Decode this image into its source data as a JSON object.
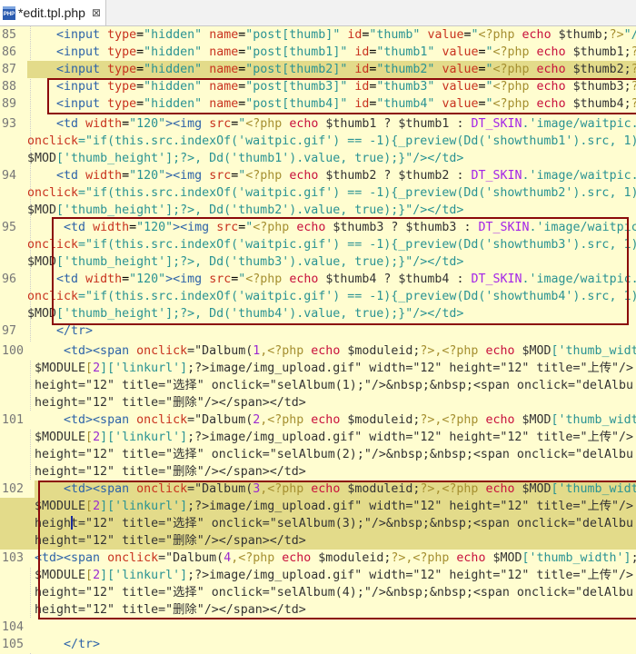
{
  "tab": {
    "title": "*edit.tpl.php",
    "icon": "php-file-icon",
    "close": "⊠"
  },
  "colors": {
    "background": "#fffdd0",
    "highlight": "#e3db8a",
    "box": "#8b0a0a"
  },
  "rows": [
    {
      "n": "85",
      "segs": [
        [
          "    ",
          ""
        ],
        [
          "<input",
          "t"
        ],
        [
          " ",
          ""
        ],
        [
          "type",
          "a"
        ],
        [
          "=",
          ""
        ],
        [
          "\"hidden\"",
          "s"
        ],
        [
          " ",
          ""
        ],
        [
          "name",
          "a"
        ],
        [
          "=",
          ""
        ],
        [
          "\"post[thumb]\"",
          "s"
        ],
        [
          " ",
          ""
        ],
        [
          "id",
          "a"
        ],
        [
          "=",
          ""
        ],
        [
          "\"thumb\"",
          "s"
        ],
        [
          " ",
          ""
        ],
        [
          "value",
          "a"
        ],
        [
          "=",
          ""
        ],
        [
          "\"",
          "s"
        ],
        [
          "<?php",
          "p"
        ],
        [
          " ",
          ""
        ],
        [
          "echo",
          "k"
        ],
        [
          " $thumb;",
          "v"
        ],
        [
          "?>",
          "p"
        ],
        [
          "\"/",
          "s"
        ]
      ]
    },
    {
      "n": "86",
      "segs": [
        [
          "    ",
          ""
        ],
        [
          "<input",
          "t"
        ],
        [
          " ",
          ""
        ],
        [
          "type",
          "a"
        ],
        [
          "=",
          ""
        ],
        [
          "\"hidden\"",
          "s"
        ],
        [
          " ",
          ""
        ],
        [
          "name",
          "a"
        ],
        [
          "=",
          ""
        ],
        [
          "\"post[thumb1]\"",
          "s"
        ],
        [
          " ",
          ""
        ],
        [
          "id",
          "a"
        ],
        [
          "=",
          ""
        ],
        [
          "\"thumb1\"",
          "s"
        ],
        [
          " ",
          ""
        ],
        [
          "value",
          "a"
        ],
        [
          "=",
          ""
        ],
        [
          "\"",
          "s"
        ],
        [
          "<?php",
          "p"
        ],
        [
          " ",
          ""
        ],
        [
          "echo",
          "k"
        ],
        [
          " $thumb1;",
          "v"
        ],
        [
          "?",
          "p"
        ]
      ]
    },
    {
      "n": "87",
      "hl": true,
      "segs": [
        [
          "    ",
          ""
        ],
        [
          "<input",
          "t"
        ],
        [
          " ",
          ""
        ],
        [
          "type",
          "a"
        ],
        [
          "=",
          ""
        ],
        [
          "\"hidden\"",
          "s"
        ],
        [
          " ",
          ""
        ],
        [
          "name",
          "a"
        ],
        [
          "=",
          ""
        ],
        [
          "\"post[thumb2]\"",
          "s"
        ],
        [
          " ",
          ""
        ],
        [
          "id",
          "a"
        ],
        [
          "=",
          ""
        ],
        [
          "\"thumb2\"",
          "s"
        ],
        [
          " ",
          ""
        ],
        [
          "value",
          "a"
        ],
        [
          "=",
          ""
        ],
        [
          "\"",
          "s"
        ],
        [
          "<?php",
          "p"
        ],
        [
          " ",
          ""
        ],
        [
          "echo",
          "k"
        ],
        [
          " $thumb2;",
          "v"
        ],
        [
          "?",
          "p"
        ]
      ]
    },
    {
      "n": "88",
      "segs": [
        [
          "    ",
          ""
        ],
        [
          "<input",
          "t"
        ],
        [
          " ",
          ""
        ],
        [
          "type",
          "a"
        ],
        [
          "=",
          ""
        ],
        [
          "\"hidden\"",
          "s"
        ],
        [
          " ",
          ""
        ],
        [
          "name",
          "a"
        ],
        [
          "=",
          ""
        ],
        [
          "\"post[thumb3]\"",
          "s"
        ],
        [
          " ",
          ""
        ],
        [
          "id",
          "a"
        ],
        [
          "=",
          ""
        ],
        [
          "\"thumb3\"",
          "s"
        ],
        [
          " ",
          ""
        ],
        [
          "value",
          "a"
        ],
        [
          "=",
          ""
        ],
        [
          "\"",
          "s"
        ],
        [
          "<?php",
          "p"
        ],
        [
          " ",
          ""
        ],
        [
          "echo",
          "k"
        ],
        [
          " $thumb3;",
          "v"
        ],
        [
          "?",
          "p"
        ]
      ]
    },
    {
      "n": "89",
      "segs": [
        [
          "    ",
          ""
        ],
        [
          "<input",
          "t"
        ],
        [
          " ",
          ""
        ],
        [
          "type",
          "a"
        ],
        [
          "=",
          ""
        ],
        [
          "\"hidden\"",
          "s"
        ],
        [
          " ",
          ""
        ],
        [
          "name",
          "a"
        ],
        [
          "=",
          ""
        ],
        [
          "\"post[thumb4]\"",
          "s"
        ],
        [
          " ",
          ""
        ],
        [
          "id",
          "a"
        ],
        [
          "=",
          ""
        ],
        [
          "\"thumb4\"",
          "s"
        ],
        [
          " ",
          ""
        ],
        [
          "value",
          "a"
        ],
        [
          "=",
          ""
        ],
        [
          "\"",
          "s"
        ],
        [
          "<?php",
          "p"
        ],
        [
          " ",
          ""
        ],
        [
          "echo",
          "k"
        ],
        [
          " $thumb4;",
          "v"
        ],
        [
          "?",
          "p"
        ]
      ]
    },
    {
      "n": "93",
      "gap": true,
      "segs": [
        [
          "    ",
          ""
        ],
        [
          "<td",
          "t"
        ],
        [
          " ",
          ""
        ],
        [
          "width",
          "a"
        ],
        [
          "=",
          ""
        ],
        [
          "\"120\"",
          "s"
        ],
        [
          "><img",
          "t"
        ],
        [
          " ",
          ""
        ],
        [
          "src",
          "a"
        ],
        [
          "=",
          ""
        ],
        [
          "\"",
          "s"
        ],
        [
          "<?php",
          "p"
        ],
        [
          " ",
          ""
        ],
        [
          "echo",
          "k"
        ],
        [
          " $thumb1 ? $thumb1 : ",
          "v"
        ],
        [
          "DT_SKIN",
          "c"
        ],
        [
          ".'image/waitpic.",
          "s"
        ]
      ]
    },
    {
      "n": "",
      "segs": [
        [
          "onclick",
          "a"
        ],
        [
          "=\"if(this.src.indexOf('waitpic.gif') == -1){_preview(Dd('showthumb1').src, 1)",
          "s"
        ]
      ]
    },
    {
      "n": "",
      "segs": [
        [
          "$MOD",
          "v"
        ],
        [
          "['thumb_height'];?>, Dd('thumb1').value, true);}\"/></td>",
          "s"
        ]
      ]
    },
    {
      "n": "94",
      "segs": [
        [
          "    ",
          ""
        ],
        [
          "<td",
          "t"
        ],
        [
          " ",
          ""
        ],
        [
          "width",
          "a"
        ],
        [
          "=",
          ""
        ],
        [
          "\"120\"",
          "s"
        ],
        [
          "><img",
          "t"
        ],
        [
          " ",
          ""
        ],
        [
          "src",
          "a"
        ],
        [
          "=",
          ""
        ],
        [
          "\"",
          "s"
        ],
        [
          "<?php",
          "p"
        ],
        [
          " ",
          ""
        ],
        [
          "echo",
          "k"
        ],
        [
          " $thumb2 ? $thumb2 : ",
          "v"
        ],
        [
          "DT_SKIN",
          "c"
        ],
        [
          ".'image/waitpic.",
          "s"
        ]
      ]
    },
    {
      "n": "",
      "segs": [
        [
          "onclick",
          "a"
        ],
        [
          "=\"if(this.src.indexOf('waitpic.gif') == -1){_preview(Dd('showthumb2').src, 1)",
          "s"
        ]
      ]
    },
    {
      "n": "",
      "segs": [
        [
          "$MOD",
          "v"
        ],
        [
          "['thumb_height'];?>, Dd('thumb2').value, true);}\"/></td>",
          "s"
        ]
      ]
    },
    {
      "n": "95",
      "segs": [
        [
          "     ",
          ""
        ],
        [
          "<td",
          "t"
        ],
        [
          " ",
          ""
        ],
        [
          "width",
          "a"
        ],
        [
          "=",
          ""
        ],
        [
          "\"120\"",
          "s"
        ],
        [
          "><img",
          "t"
        ],
        [
          " ",
          ""
        ],
        [
          "src",
          "a"
        ],
        [
          "=",
          ""
        ],
        [
          "\"",
          "s"
        ],
        [
          "<?php",
          "p"
        ],
        [
          " ",
          ""
        ],
        [
          "echo",
          "k"
        ],
        [
          " $thumb3 ? $thumb3 : ",
          "v"
        ],
        [
          "DT_SKIN",
          "c"
        ],
        [
          ".'image/waitpic",
          "s"
        ]
      ]
    },
    {
      "n": "",
      "segs": [
        [
          "onclick",
          "a"
        ],
        [
          "=\"if(this.src.indexOf('waitpic.gif') == -1){_preview(Dd('showthumb3').src, 1)",
          "s"
        ]
      ]
    },
    {
      "n": "",
      "segs": [
        [
          "$MOD",
          "v"
        ],
        [
          "['thumb_height'];?>, Dd('thumb3').value, true);}\"/></td>",
          "s"
        ]
      ]
    },
    {
      "n": "96",
      "segs": [
        [
          "    ",
          ""
        ],
        [
          "<td",
          "t"
        ],
        [
          " ",
          ""
        ],
        [
          "width",
          "a"
        ],
        [
          "=",
          ""
        ],
        [
          "\"120\"",
          "s"
        ],
        [
          "><img",
          "t"
        ],
        [
          " ",
          ""
        ],
        [
          "src",
          "a"
        ],
        [
          "=",
          ""
        ],
        [
          "\"",
          "s"
        ],
        [
          "<?php",
          "p"
        ],
        [
          " ",
          ""
        ],
        [
          "echo",
          "k"
        ],
        [
          " $thumb4 ? $thumb4 : ",
          "v"
        ],
        [
          "DT_SKIN",
          "c"
        ],
        [
          ".'image/waitpic.",
          "s"
        ]
      ]
    },
    {
      "n": "",
      "segs": [
        [
          "onclick",
          "a"
        ],
        [
          "=\"if(this.src.indexOf('waitpic.gif') == -1){_preview(Dd('showthumb4').src, 1)",
          "s"
        ]
      ]
    },
    {
      "n": "",
      "segs": [
        [
          "$MOD",
          "v"
        ],
        [
          "['thumb_height'];?>, Dd('thumb4').value, true);}\"/></td>",
          "s"
        ]
      ]
    },
    {
      "n": "97",
      "segs": [
        [
          "    ",
          ""
        ],
        [
          "</tr>",
          "t"
        ]
      ]
    },
    {
      "n": "100",
      "wide": true,
      "gap": true,
      "segs": [
        [
          "    ",
          ""
        ],
        [
          "<td><span",
          "t"
        ],
        [
          " ",
          ""
        ],
        [
          "onclick",
          "a"
        ],
        [
          "=\"Dalbum(",
          "v"
        ],
        [
          "1",
          "n"
        ],
        [
          ",<?php",
          "p"
        ],
        [
          " ",
          ""
        ],
        [
          "echo",
          "k"
        ],
        [
          " $moduleid;",
          "v"
        ],
        [
          "?>,<?php",
          "p"
        ],
        [
          " ",
          ""
        ],
        [
          "echo",
          "k"
        ],
        [
          " $MOD",
          "v"
        ],
        [
          "['thumb_widt",
          "s"
        ]
      ]
    },
    {
      "n": "",
      "wide": true,
      "segs": [
        [
          "$MODULE",
          "v"
        ],
        [
          "[",
          "p"
        ],
        [
          "2",
          "n"
        ],
        [
          "]['linkurl']",
          "s"
        ],
        [
          ";?>image/img_upload.gif\" width=\"12\" height=\"12\" title=\"上传\"/>",
          "v"
        ]
      ]
    },
    {
      "n": "",
      "wide": true,
      "segs": [
        [
          "height=\"12\" title=\"选择\" onclick=\"selAlbum(1);\"/>&nbsp;&nbsp;<span onclick=\"delAlbu",
          "v"
        ]
      ]
    },
    {
      "n": "",
      "wide": true,
      "segs": [
        [
          "height=\"12\" title=\"删除\"/></span></td>",
          "v"
        ]
      ]
    },
    {
      "n": "101",
      "wide": true,
      "segs": [
        [
          "    ",
          ""
        ],
        [
          "<td><span",
          "t"
        ],
        [
          " ",
          ""
        ],
        [
          "onclick",
          "a"
        ],
        [
          "=\"Dalbum(",
          "v"
        ],
        [
          "2",
          "n"
        ],
        [
          ",<?php",
          "p"
        ],
        [
          " ",
          ""
        ],
        [
          "echo",
          "k"
        ],
        [
          " $moduleid;",
          "v"
        ],
        [
          "?>,<?php",
          "p"
        ],
        [
          " ",
          ""
        ],
        [
          "echo",
          "k"
        ],
        [
          " $MOD",
          "v"
        ],
        [
          "['thumb_widt",
          "s"
        ]
      ]
    },
    {
      "n": "",
      "wide": true,
      "segs": [
        [
          "$MODULE",
          "v"
        ],
        [
          "[",
          "p"
        ],
        [
          "2",
          "n"
        ],
        [
          "]['linkurl']",
          "s"
        ],
        [
          ";?>image/img_upload.gif\" width=\"12\" height=\"12\" title=\"上传\"/>",
          "v"
        ]
      ]
    },
    {
      "n": "",
      "wide": true,
      "segs": [
        [
          "height=\"12\" title=\"选择\" onclick=\"selAlbum(2);\"/>&nbsp;&nbsp;<span onclick=\"delAlbu",
          "v"
        ]
      ]
    },
    {
      "n": "",
      "wide": true,
      "segs": [
        [
          "height=\"12\" title=\"删除\"/></span></td>",
          "v"
        ]
      ]
    },
    {
      "n": "102",
      "wide": true,
      "hl": true,
      "segs": [
        [
          "    ",
          ""
        ],
        [
          "<td><span",
          "t"
        ],
        [
          " ",
          ""
        ],
        [
          "onclick",
          "a"
        ],
        [
          "=\"Dalbum(",
          "v"
        ],
        [
          "3",
          "n"
        ],
        [
          ",<?php",
          "p"
        ],
        [
          " ",
          ""
        ],
        [
          "echo",
          "k"
        ],
        [
          " $moduleid;",
          "v"
        ],
        [
          "?>,<?php",
          "p"
        ],
        [
          " ",
          ""
        ],
        [
          "echo",
          "k"
        ],
        [
          " $MOD",
          "v"
        ],
        [
          "['thumb_widt",
          "s"
        ]
      ]
    },
    {
      "n": "",
      "wide": true,
      "hl": true,
      "segs": [
        [
          "$MODULE",
          "v"
        ],
        [
          "[",
          "p"
        ],
        [
          "2",
          "n"
        ],
        [
          "]['linkurl']",
          "s"
        ],
        [
          ";?>image/img_upload.gif\" width=\"12\" height=\"12\" title=\"上传\"/>",
          "v"
        ]
      ]
    },
    {
      "n": "",
      "wide": true,
      "hl": true,
      "segs": [
        [
          "height=\"12\" title=\"选择\" onclick=\"selAlbum(3);\"/>&nbsp;&nbsp;<span onclick=\"delAlbu",
          "v"
        ]
      ]
    },
    {
      "n": "",
      "wide": true,
      "hl": true,
      "segs": [
        [
          "height=\"12\" title=\"删除\"/></span></td>",
          "v"
        ]
      ]
    },
    {
      "n": "103",
      "wide": true,
      "segs": [
        [
          "<td><span",
          "t"
        ],
        [
          " ",
          ""
        ],
        [
          "onclick",
          "a"
        ],
        [
          "=\"Dalbum(",
          "v"
        ],
        [
          "4",
          "n"
        ],
        [
          ",<?php",
          "p"
        ],
        [
          " ",
          ""
        ],
        [
          "echo",
          "k"
        ],
        [
          " $moduleid;",
          "v"
        ],
        [
          "?>,<?php",
          "p"
        ],
        [
          " ",
          ""
        ],
        [
          "echo",
          "k"
        ],
        [
          " $MOD",
          "v"
        ],
        [
          "['thumb_width']",
          "s"
        ],
        [
          ";",
          "v"
        ]
      ]
    },
    {
      "n": "",
      "wide": true,
      "segs": [
        [
          "$MODULE",
          "v"
        ],
        [
          "[",
          "p"
        ],
        [
          "2",
          "n"
        ],
        [
          "]['linkurl']",
          "s"
        ],
        [
          ";?>image/img_upload.gif\" width=\"12\" height=\"12\" title=\"上传\"/>",
          "v"
        ]
      ]
    },
    {
      "n": "",
      "wide": true,
      "segs": [
        [
          "height=\"12\" title=\"选择\" onclick=\"selAlbum(4);\"/>&nbsp;&nbsp;<span onclick=\"delAlbu",
          "v"
        ]
      ]
    },
    {
      "n": "",
      "wide": true,
      "segs": [
        [
          "height=\"12\" title=\"删除\"/></span></td>",
          "v"
        ]
      ]
    },
    {
      "n": "104",
      "wide": true,
      "segs": []
    },
    {
      "n": "105",
      "wide": true,
      "segs": [
        [
          "    ",
          ""
        ],
        [
          "</tr>",
          "t"
        ]
      ]
    }
  ]
}
